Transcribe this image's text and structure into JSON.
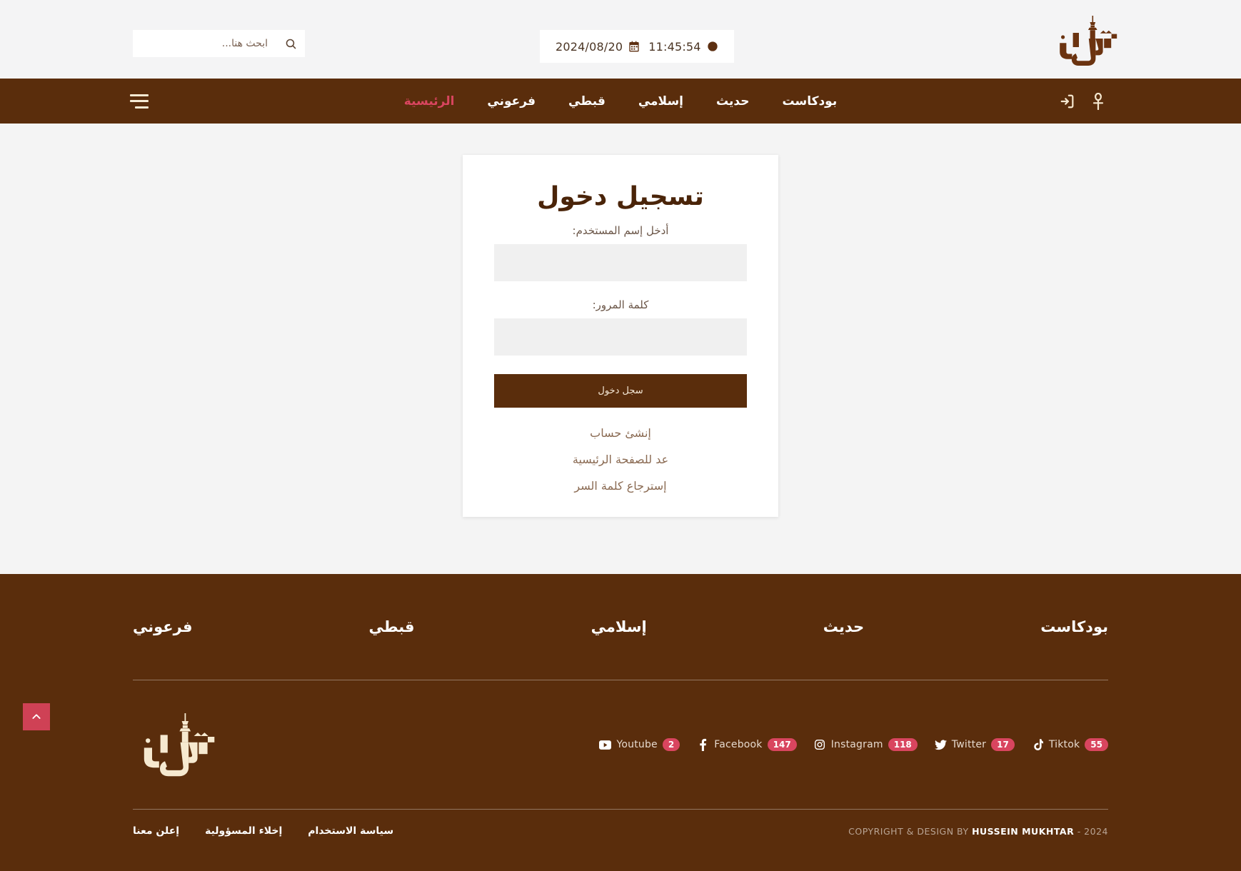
{
  "topbar": {
    "search": {
      "placeholder": "ابحث هنا...",
      "value": "",
      "icon": "search-icon"
    },
    "datetime": {
      "date": "2024/08/20",
      "time": "11:45:54",
      "date_icon": "calendar-icon",
      "time_icon": "clock-icon"
    },
    "logo_alt": "ترجمان"
  },
  "nav": {
    "links": [
      {
        "label": "الرئيسية",
        "active": true
      },
      {
        "label": "فرعوني",
        "active": false
      },
      {
        "label": "قبطي",
        "active": false
      },
      {
        "label": "إسلامي",
        "active": false
      },
      {
        "label": "حديث",
        "active": false
      },
      {
        "label": "بودكاست",
        "active": false
      }
    ],
    "icons": [
      {
        "name": "login-icon"
      },
      {
        "name": "ankh-icon"
      }
    ],
    "menu_icon": "hamburger-menu-icon"
  },
  "login": {
    "title": "تسجيل دخول",
    "username_label": "أدخل إسم المستخدم:",
    "username_value": "",
    "username_placeholder": "",
    "password_label": "كلمة المرور:",
    "password_value": "",
    "password_placeholder": "",
    "submit_label": "سجل دخول",
    "links": [
      "إنشئ حساب",
      "عد للصفحة الرئيسية",
      "إسترجاع كلمة السر"
    ]
  },
  "footer": {
    "columns": [
      "فرعوني",
      "قبطي",
      "إسلامي",
      "حديث",
      "بودكاست"
    ],
    "socials": [
      {
        "name": "Youtube",
        "count": "2",
        "icon": "youtube-icon"
      },
      {
        "name": "Facebook",
        "count": "147",
        "icon": "facebook-icon"
      },
      {
        "name": "Instagram",
        "count": "118",
        "icon": "instagram-icon"
      },
      {
        "name": "Twitter",
        "count": "17",
        "icon": "twitter-icon"
      },
      {
        "name": "Tiktok",
        "count": "55",
        "icon": "tiktok-icon"
      }
    ],
    "legal_links": [
      "سياسة الاستخدام",
      "إخلاء المسؤولية",
      "إعلن معنا"
    ],
    "copyright_prefix": "COPYRIGHT & DESIGN BY",
    "copyright_name": "HUSSEIN MUKHTAR",
    "copyright_suffix": "- 2024",
    "logo_alt": "ترجمان"
  },
  "scroll_top": {
    "icon": "chevron-up-icon"
  },
  "colors": {
    "brand_brown": "#5a2d0c",
    "accent_red": "#d9455f",
    "page_bg": "#f4f4f4",
    "card_bg": "#ffffff",
    "input_bg": "#f0f0f0",
    "cream": "#f6e9d7"
  }
}
